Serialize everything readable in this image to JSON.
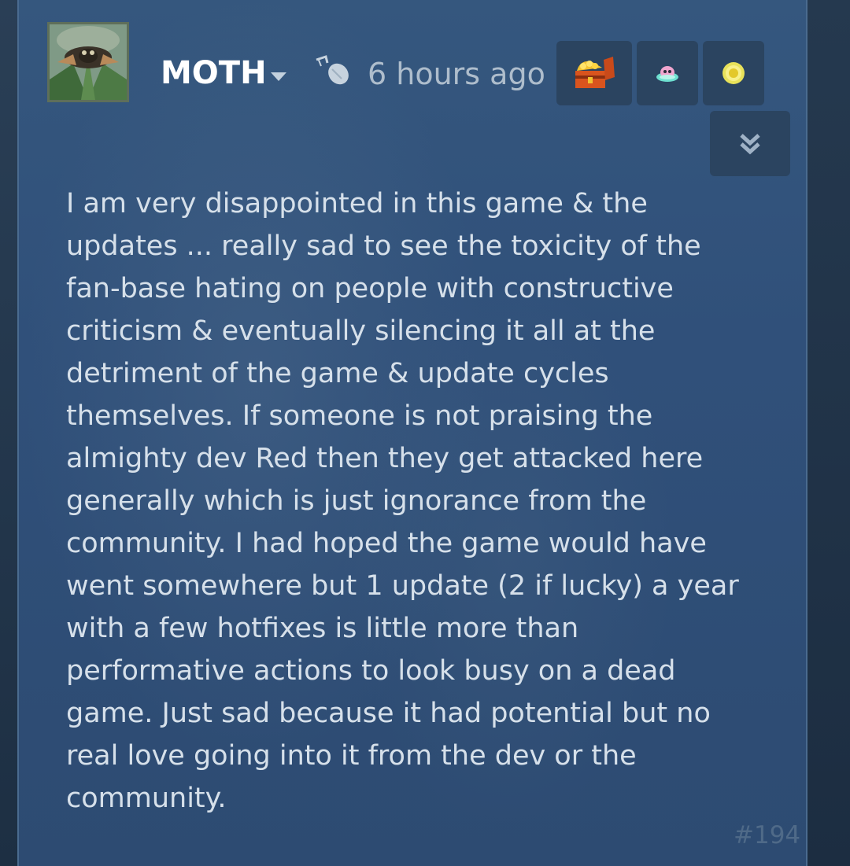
{
  "comment": {
    "author": "MOTH",
    "timestamp": "6 hours ago",
    "body": "I am very disappointed in this game & the\nupdates ... really sad to see the toxicity of the\nfan-base hating on people with constructive\ncriticism & eventually silencing it all at the\ndetriment of the game & update cycles\nthemselves. If someone is not praising the\nalmighty dev Red then they get attacked here\ngenerally which is just ignorance from the\ncommunity. I had hoped the game would have\nwent somewhere but 1 update (2 if lucky) a year\nwith a few hotfixes is little more than\nperformative actions to look busy on a dead\ngame. Just sad because it had potential but no\nreal love going into it from the dev or the\ncommunity.",
    "number": "#194"
  },
  "icons": {
    "avatar": "moth-avatar",
    "author_menu": "chevron-down-icon",
    "device": "mouse-icon",
    "award_1": "treasure-chest-icon",
    "award_2": "pink-creature-icon",
    "award_3": "gold-coin-icon",
    "expand": "double-chevron-down-icon"
  },
  "colors": {
    "card_background": "#30507a",
    "author_text": "#ffffff",
    "body_text": "#d6e0ea",
    "timestamp_text": "#aebdcc",
    "badge_background": "#2b4460"
  }
}
